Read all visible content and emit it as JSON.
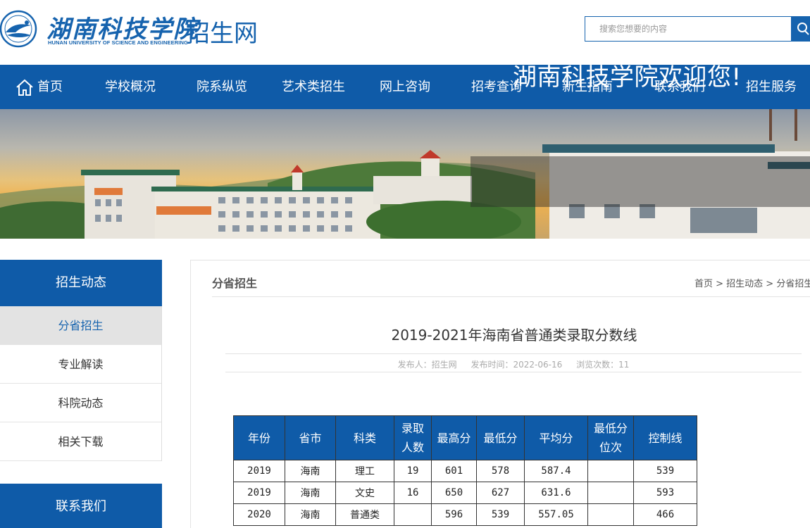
{
  "header": {
    "logo_cn": "湖南科技学院",
    "logo_en": "HUNAN UNIVERSITY OF SCIENCE AND ENGINEERING",
    "site_name": "招生网",
    "search_placeholder": "搜索您想要的内容",
    "brand_color": "#0f5ba8"
  },
  "nav": {
    "items": [
      "首页",
      "学校概况",
      "院系纵览",
      "艺术类招生",
      "网上咨询",
      "招考查询",
      "新生指南",
      "联系我们",
      "招生服务"
    ]
  },
  "banner": {
    "welcome": "湖南科技学院欢迎您!"
  },
  "sidebar": {
    "heading": "招生动态",
    "items": [
      {
        "label": "分省招生",
        "active": true
      },
      {
        "label": "专业解读",
        "active": false
      },
      {
        "label": "科院动态",
        "active": false
      },
      {
        "label": "相关下载",
        "active": false
      }
    ],
    "heading2": "联系我们"
  },
  "content": {
    "section_title": "分省招生",
    "breadcrumb": "首页 > 招生动态 > 分省招生",
    "article_title": "2019-2021年海南省普通类录取分数线",
    "meta_author": "发布人：招生网",
    "meta_date": "发布时间：2022-06-16",
    "meta_views": "浏览次数：11"
  },
  "table": {
    "headers": [
      "年份",
      "省市",
      "科类",
      "录取人数",
      "最高分",
      "最低分",
      "平均分",
      "最低分位次",
      "控制线"
    ],
    "header_lines": [
      [
        "年份"
      ],
      [
        "省市"
      ],
      [
        "科类"
      ],
      [
        "录取",
        "人数"
      ],
      [
        "最高分"
      ],
      [
        "最低分"
      ],
      [
        "平均分"
      ],
      [
        "最低分",
        "位次"
      ],
      [
        "控制线"
      ]
    ],
    "rows": [
      [
        "2019",
        "海南",
        "理工",
        "19",
        "601",
        "578",
        "587.4",
        "",
        "539"
      ],
      [
        "2019",
        "海南",
        "文史",
        "16",
        "650",
        "627",
        "631.6",
        "",
        "593"
      ],
      [
        "2020",
        "海南",
        "普通类",
        "",
        "596",
        "539",
        "557.05",
        "",
        "466"
      ]
    ]
  }
}
